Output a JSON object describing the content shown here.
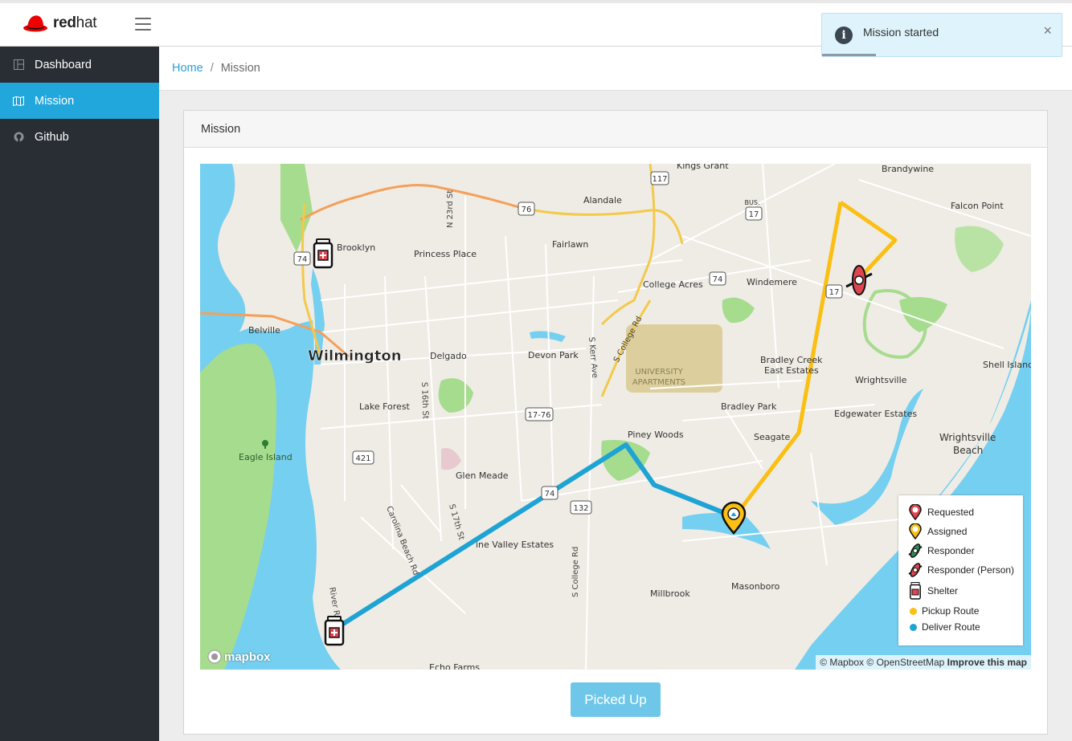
{
  "brand": {
    "name_bold": "red",
    "name_light": "hat"
  },
  "sidebar": {
    "items": [
      {
        "label": "Dashboard",
        "icon": "dashboard-icon",
        "active": false
      },
      {
        "label": "Mission",
        "icon": "map-icon",
        "active": true
      },
      {
        "label": "Github",
        "icon": "github-icon",
        "active": false
      }
    ]
  },
  "breadcrumb": {
    "home": "Home",
    "separator": "/",
    "current": "Mission"
  },
  "card": {
    "title": "Mission"
  },
  "map": {
    "places": {
      "kings_grant": "Kings Grant",
      "brandywine": "Brandywine",
      "alandale": "Alandale",
      "falcon_point": "Falcon Point",
      "brooklyn": "Brooklyn",
      "princess_place": "Princess Place",
      "fairlawn": "Fairlawn",
      "college_acres": "College Acres",
      "windemere": "Windemere",
      "belville": "Belville",
      "wilmington": "Wilmington",
      "delgado": "Delgado",
      "devon_park": "Devon Park",
      "university_apartments_1": "UNIVERSITY",
      "university_apartments_2": "APARTMENTS",
      "bradley_creek_1": "Bradley Creek",
      "bradley_creek_2": "East Estates",
      "wrightsville": "Wrightsville",
      "shell_island": "Shell Island",
      "lake_forest": "Lake Forest",
      "bradley_park": "Bradley Park",
      "edgewater_estates": "Edgewater Estates",
      "piney_woods": "Piney Woods",
      "seagate": "Seagate",
      "wrightsville_beach_1": "Wrightsville",
      "wrightsville_beach_2": "Beach",
      "eagle_island": "Eagle Island",
      "glen_meade": "Glen Meade",
      "pine_valley": "ine Valley Estates",
      "millbrook": "Millbrook",
      "masonboro": "Masonboro",
      "echo_farms": "Echo Farms"
    },
    "roads": {
      "n23rd": "N 23rd St",
      "s_college_1": "S College Rd",
      "s_kerr": "S Kerr Ave",
      "s16th": "S 16th St",
      "carolina_beach": "Carolina Beach Rd",
      "s17th": "S 17th St",
      "s_college_2": "S College Rd",
      "river_rd": "River R"
    },
    "shields": {
      "us117": "117",
      "us74a": "74",
      "bus17_label": "BUS.",
      "bus17": "17",
      "us74b": "74",
      "us74c": "74",
      "us17": "17",
      "us1776": "17-76",
      "us421": "421",
      "us76": "76",
      "nc132": "132"
    },
    "legend": {
      "requested": "Requested",
      "assigned": "Assigned",
      "responder": "Responder",
      "responder_person": "Responder (Person)",
      "shelter": "Shelter",
      "pickup_route": "Pickup Route",
      "deliver_route": "Deliver Route"
    },
    "colors": {
      "pickup": "#fbbf14",
      "deliver": "#1ea3d5",
      "requested": "#e0454f",
      "water": "#75cff0"
    },
    "attribution": {
      "mapbox": "© Mapbox",
      "osm": "© OpenStreetMap",
      "improve": "Improve this map"
    },
    "logo_text": "mapbox"
  },
  "actions": {
    "picked_up": "Picked Up"
  },
  "toast": {
    "message": "Mission started",
    "close": "×",
    "icon": "info-icon"
  }
}
